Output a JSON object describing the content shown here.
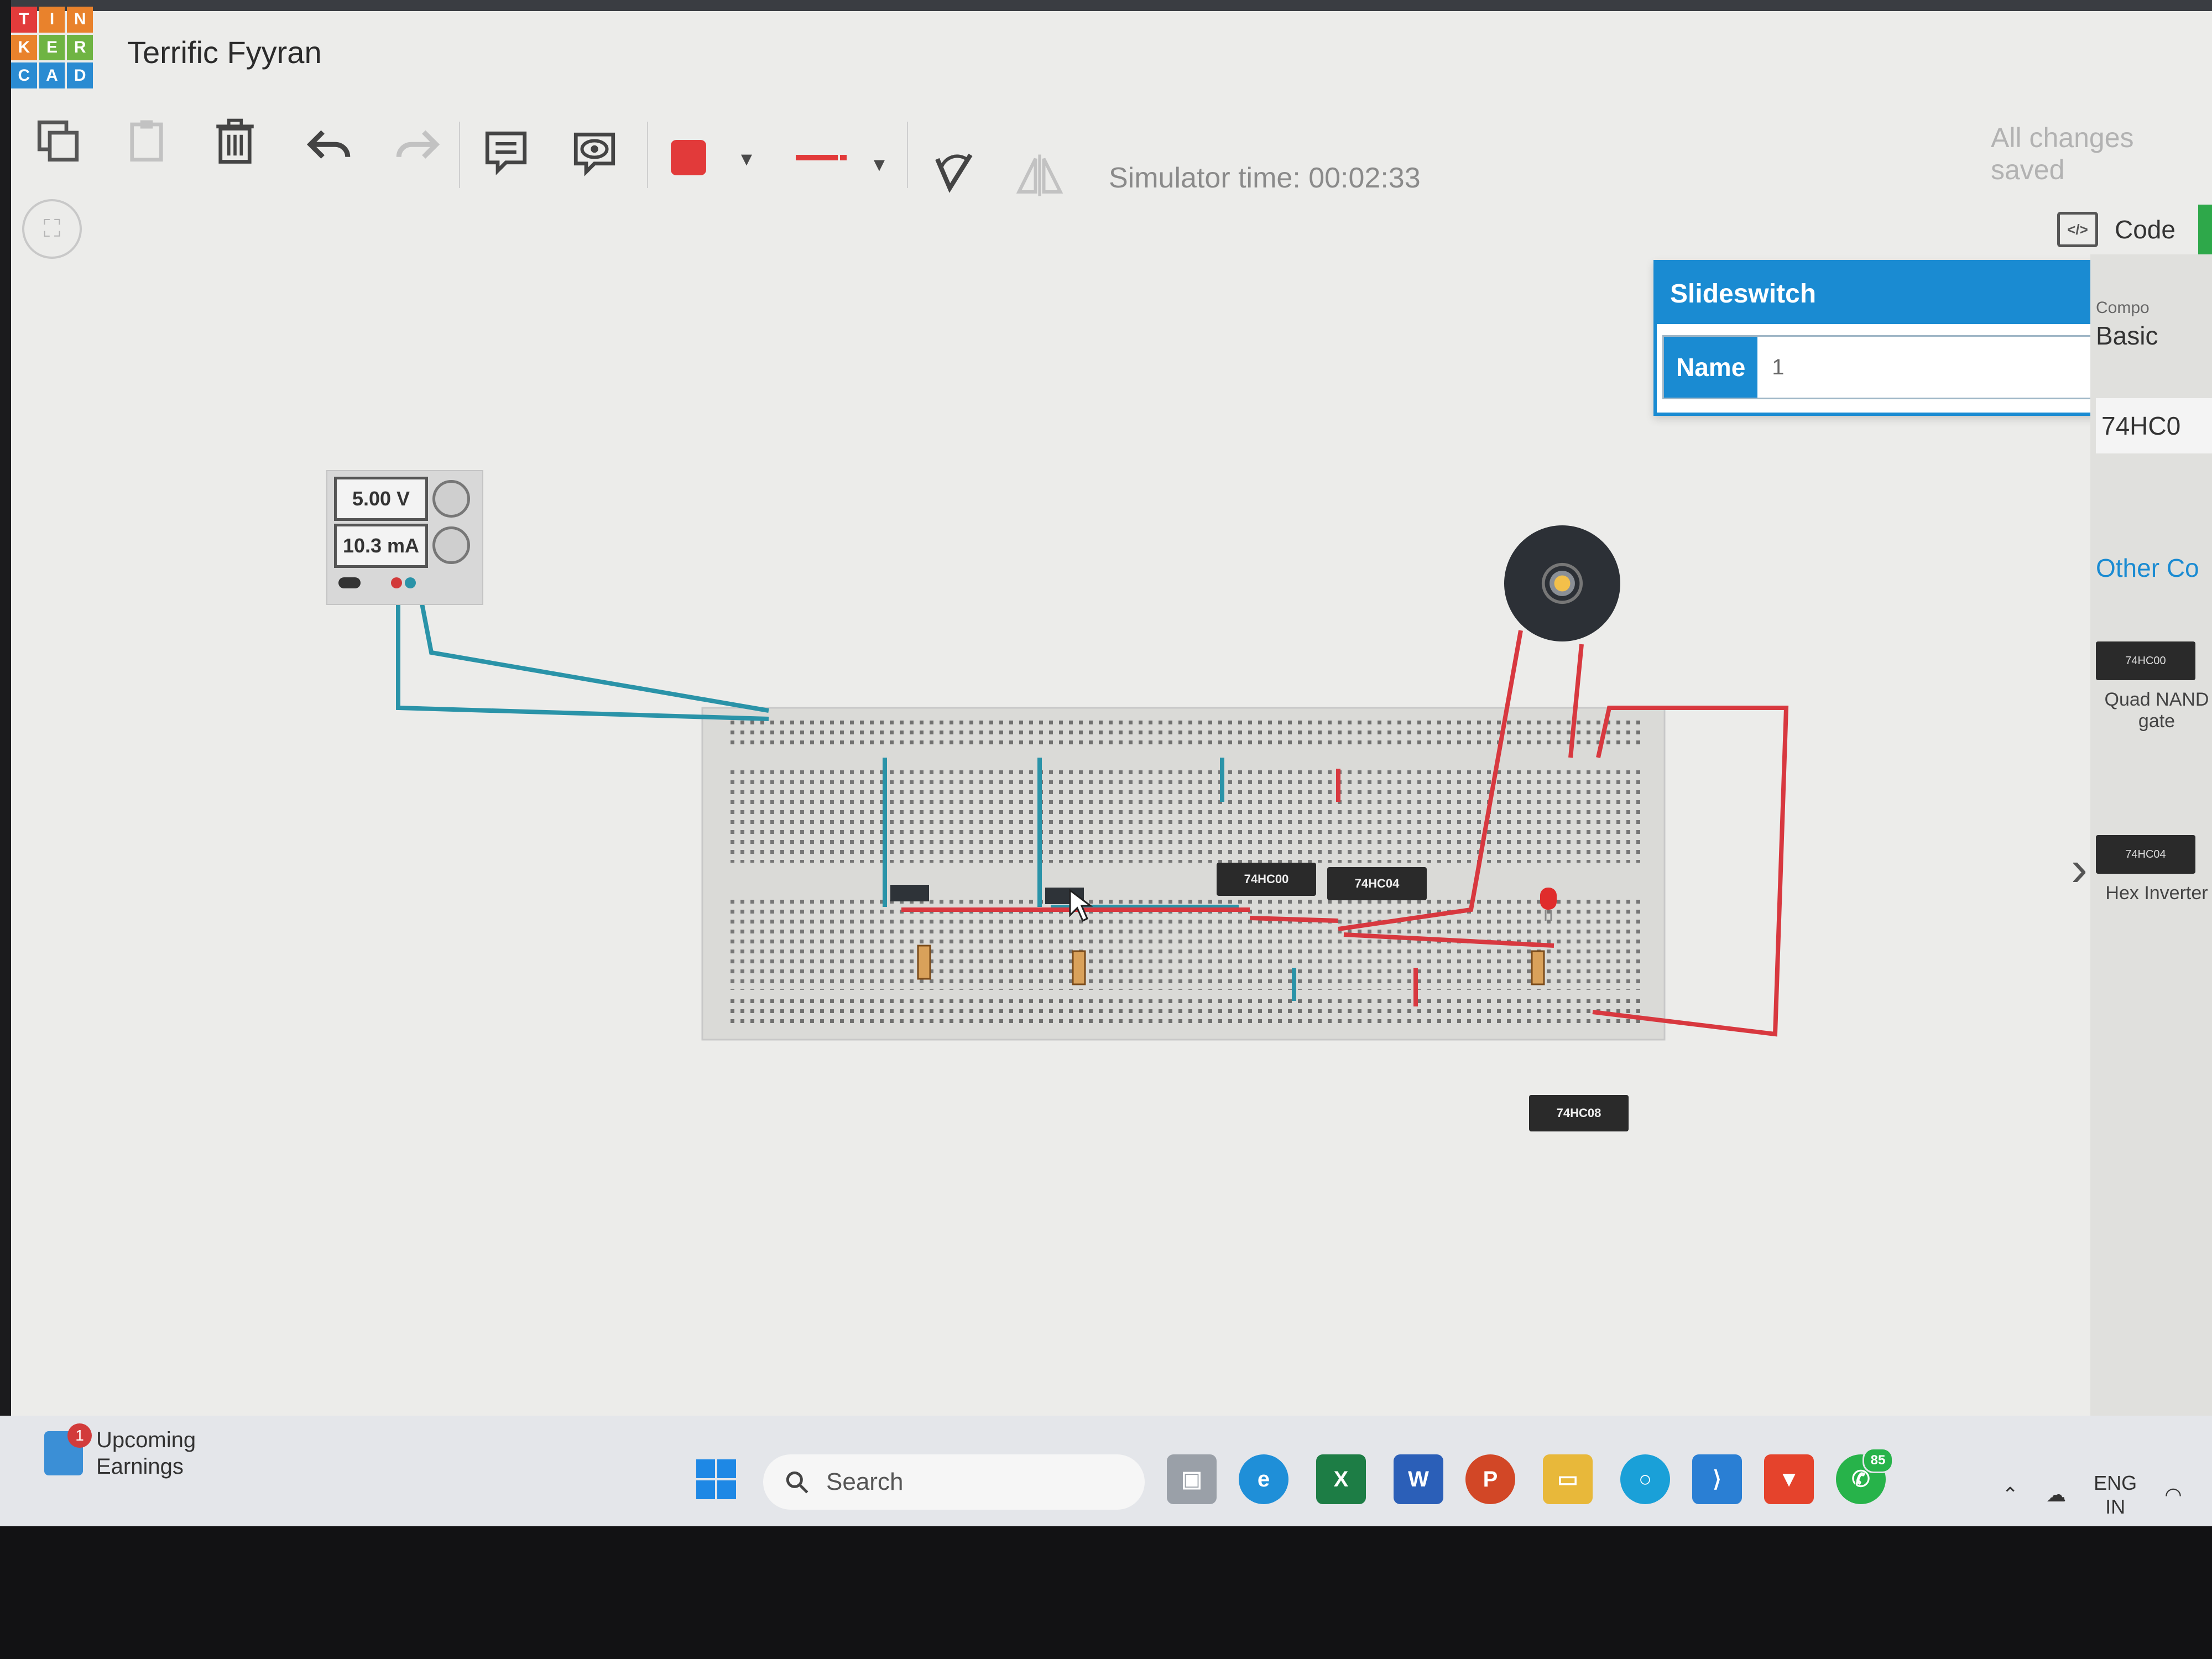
{
  "app": {
    "logo_letters": [
      "T",
      "I",
      "N",
      "K",
      "E",
      "R",
      "C",
      "A",
      "D"
    ],
    "project_title": "Terrific Fyyran",
    "status": "All changes saved",
    "simulator_time": "Simulator time: 00:02:33",
    "code_label": "Code"
  },
  "inspector": {
    "title": "Slideswitch",
    "name_label": "Name",
    "name_value": "1"
  },
  "components_panel": {
    "header_partial": "Compo",
    "dropdown_value": "Basic",
    "search_value": "74HC0",
    "section_title": "Other Co",
    "items": [
      {
        "chip_label": "74HC00",
        "caption": "Quad NAND gate"
      },
      {
        "chip_label": "74HC04",
        "caption": "Hex Inverter"
      }
    ]
  },
  "canvas": {
    "psu": {
      "voltage": "5.00 V",
      "current": "10.3 mA"
    },
    "chips": [
      {
        "label": "74HC00"
      },
      {
        "label": "74HC04"
      },
      {
        "label": "74HC08"
      }
    ]
  },
  "taskbar": {
    "widget_title": "Upcoming",
    "widget_subtitle": "Earnings",
    "widget_badge": "1",
    "search_placeholder": "Search",
    "whatsapp_badge": "85",
    "lang_line1": "ENG",
    "lang_line2": "IN"
  },
  "colors": {
    "accent_blue": "#1a8bd2",
    "wire_blue": "#2a93a8",
    "wire_red": "#d8383f",
    "record_red": "#e23a3a"
  }
}
